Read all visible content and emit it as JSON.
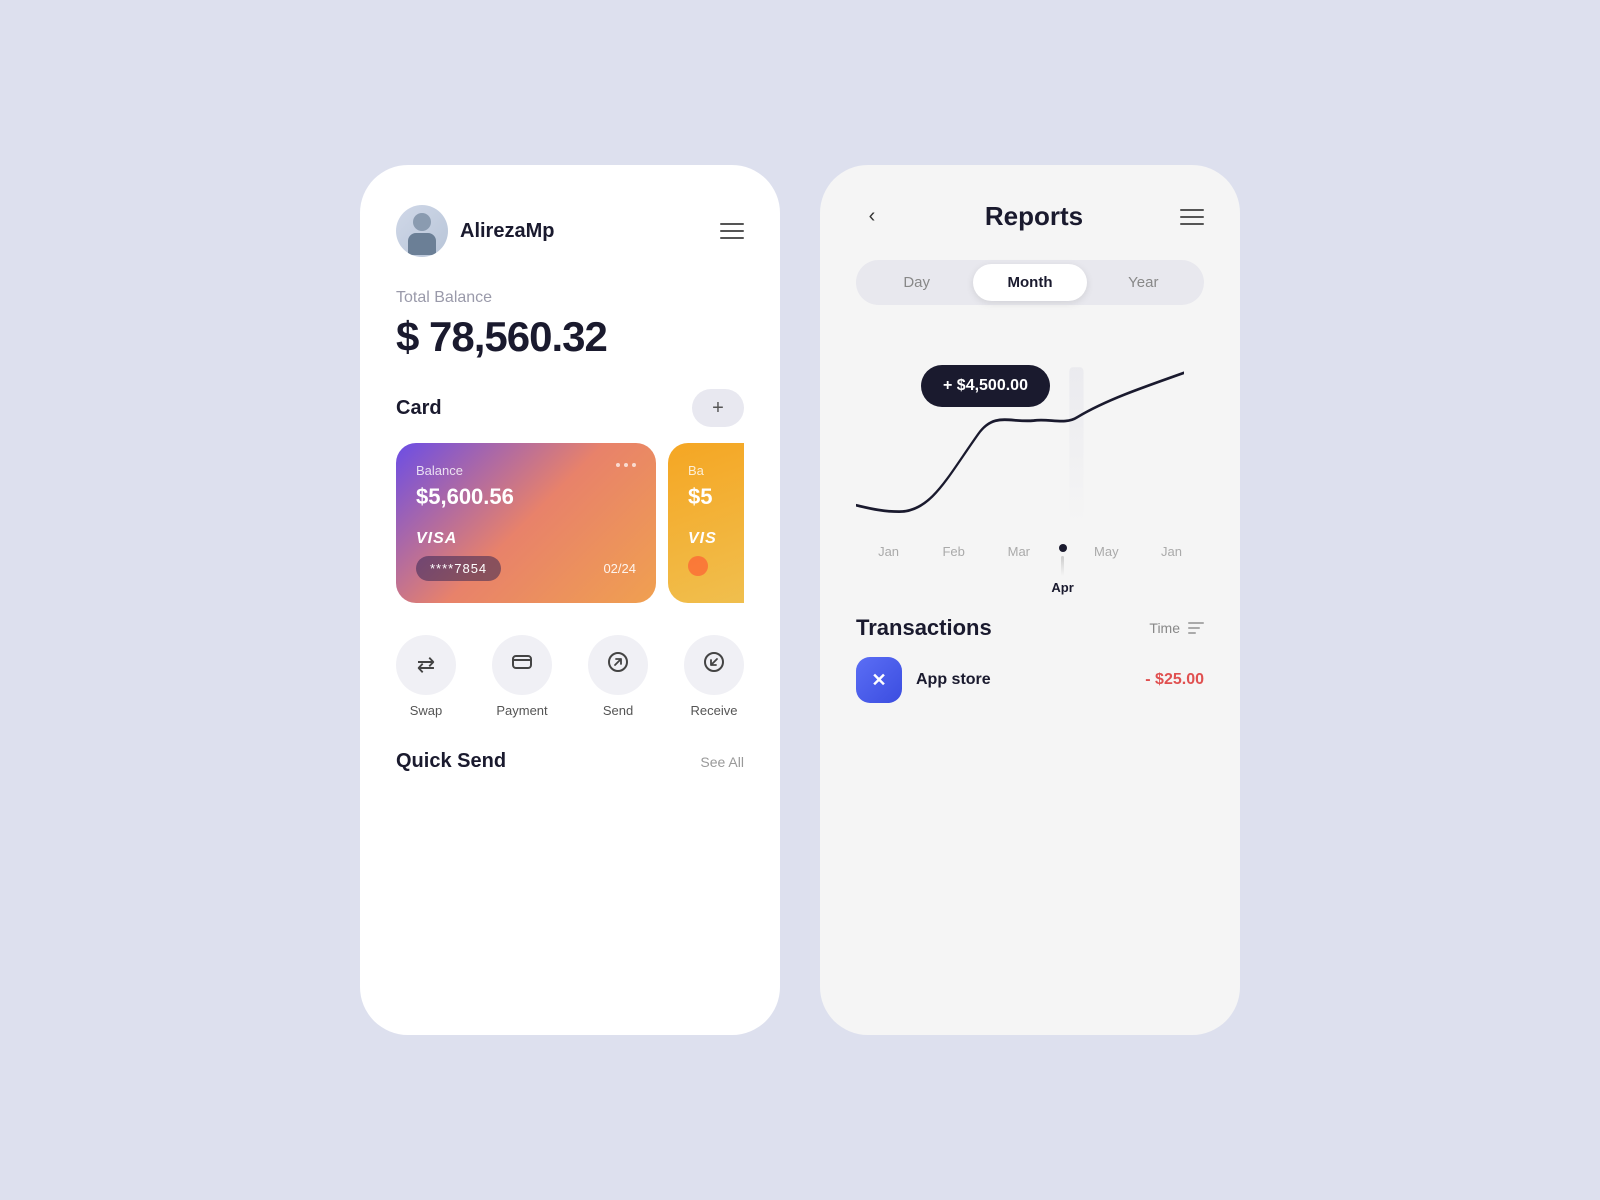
{
  "background": "#dde0ee",
  "leftPhone": {
    "user": {
      "name": "AlirezaMp"
    },
    "balance": {
      "label": "Total Balance",
      "amount": "$ 78,560.32"
    },
    "card": {
      "sectionLabel": "Card",
      "addButtonLabel": "+",
      "mainCard": {
        "balanceLabel": "Balance",
        "amount": "$5,600.56",
        "type": "VISA",
        "number": "****7854",
        "expiry": "02/24"
      },
      "secondCard": {
        "balanceLabel": "Ba",
        "amount": "$5"
      }
    },
    "actions": [
      {
        "id": "swap",
        "label": "Swap",
        "icon": "⇄"
      },
      {
        "id": "payment",
        "label": "Payment",
        "icon": "⊟"
      },
      {
        "id": "send",
        "label": "Send",
        "icon": "↗"
      },
      {
        "id": "receive",
        "label": "Receive",
        "icon": "↙"
      }
    ],
    "quickSend": {
      "label": "Quick Send",
      "seeAll": "See All"
    }
  },
  "rightPhone": {
    "backLabel": "‹",
    "title": "Reports",
    "menuIcon": "≡",
    "tabs": [
      {
        "id": "day",
        "label": "Day",
        "active": false
      },
      {
        "id": "month",
        "label": "Month",
        "active": true
      },
      {
        "id": "year",
        "label": "Year",
        "active": false
      }
    ],
    "chart": {
      "tooltip": "+ $4,500.00",
      "months": [
        {
          "label": "Jan",
          "active": false
        },
        {
          "label": "Feb",
          "active": false
        },
        {
          "label": "Mar",
          "active": false
        },
        {
          "label": "Apr",
          "active": true
        },
        {
          "label": "May",
          "active": false
        },
        {
          "label": "Jan",
          "active": false
        }
      ]
    },
    "transactions": {
      "title": "Transactions",
      "timeLabel": "Time",
      "items": [
        {
          "name": "App store",
          "icon": "✕",
          "amount": "$25.00"
        }
      ]
    }
  }
}
